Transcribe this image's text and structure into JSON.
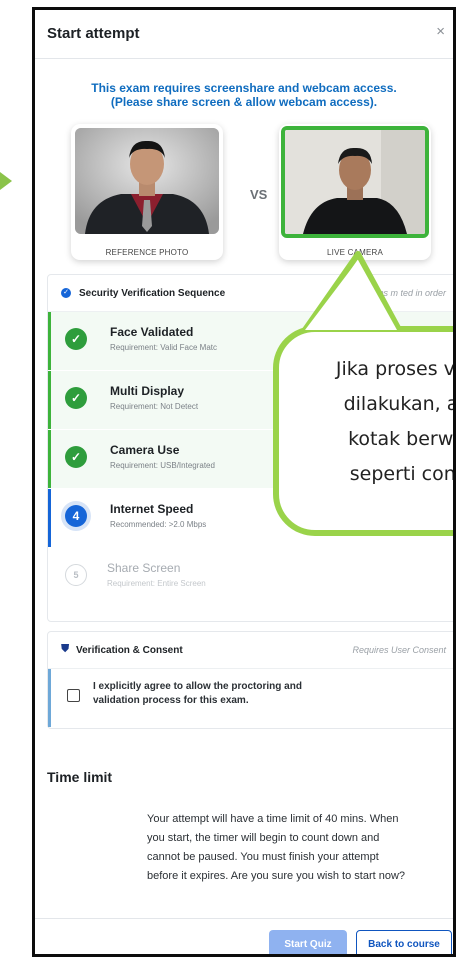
{
  "modal": {
    "title": "Start attempt",
    "close_glyph": "×"
  },
  "notice": {
    "line1": "This exam requires screenshare and webcam access.",
    "line2": "(Please share screen & allow webcam access)."
  },
  "photos": {
    "reference_label": "REFERENCE PHOTO",
    "vs_label": "VS",
    "live_label": "LIVE CAMERA"
  },
  "security": {
    "title": "Security Verification Sequence",
    "subtitle": "Steps m           ted in order",
    "steps": [
      {
        "index": "✓",
        "name": "Face Validated",
        "requirement": "Requirement: Valid Face Matc",
        "status": "done"
      },
      {
        "index": "✓",
        "name": "Multi Display",
        "requirement": "Requirement: Not Detect",
        "status": "done"
      },
      {
        "index": "✓",
        "name": "Camera Use",
        "requirement": "Requirement: USB/Integrated",
        "status": "done"
      },
      {
        "index": "4",
        "name": "Internet Speed",
        "requirement": "Recommended: >2.0 Mbps",
        "status": "active"
      },
      {
        "index": "5",
        "name": "Share Screen",
        "requirement": "Requirement: Entire Screen",
        "status": "pending"
      }
    ]
  },
  "consent": {
    "title": "Verification & Consent",
    "subtitle": "Requires User Consent",
    "checked": false,
    "line1": "I explicitly agree to allow the proctoring and",
    "line2": "validation process for this exam."
  },
  "time_limit": {
    "title": "Time limit",
    "line1": "Your attempt will have a time limit of 40 mins. When",
    "line2": "you start, the timer will begin to count down and",
    "line3": "cannot be paused. You must finish your attempt",
    "line4": "before it expires. Are you sure you wish to start now?"
  },
  "buttons": {
    "start": "Start Quiz",
    "back": "Back to course"
  },
  "callout": {
    "line1": "Jika proses vali",
    "line2": "dilakukan, ak",
    "line3": "kotak berwa",
    "line4": "seperti cont"
  },
  "colors": {
    "accent_blue": "#0f6cbf",
    "success_green": "#2e9d3c",
    "callout_green": "#9ad34a"
  }
}
